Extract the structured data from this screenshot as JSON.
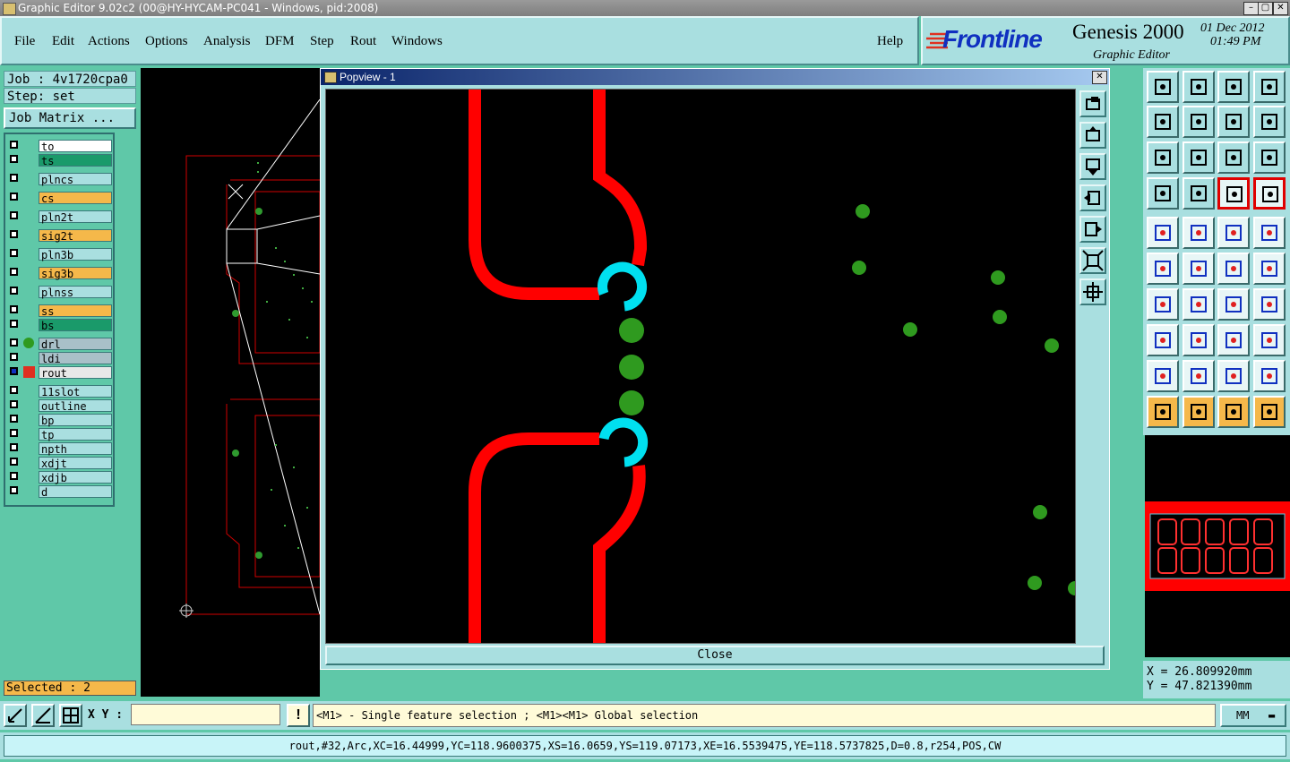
{
  "window": {
    "title": "Graphic Editor 9.02c2 (00@HY-HYCAM-PC041 - Windows, pid:2008)"
  },
  "menu": [
    "File",
    "Edit",
    "Actions",
    "Options",
    "Analysis",
    "DFM",
    "Step",
    "Rout",
    "Windows"
  ],
  "help": "Help",
  "logo": {
    "brand": "Frontline",
    "product": "Genesis 2000",
    "date": "01 Dec 2012",
    "time": "01:49 PM",
    "subtitle": "Graphic Editor"
  },
  "job": {
    "job_label": "Job : 4v1720cpa0",
    "step_label": "Step: set",
    "matrix_button": "Job Matrix ..."
  },
  "layers": [
    {
      "name": "to",
      "color": "#ffffff"
    },
    {
      "name": "ts",
      "color": "#1a9a6a"
    },
    {
      "name": "plncs",
      "color": "#a9dfe0"
    },
    {
      "name": "cs",
      "color": "#f5b84a"
    },
    {
      "name": "pln2t",
      "color": "#a9dfe0"
    },
    {
      "name": "sig2t",
      "color": "#f5b84a"
    },
    {
      "name": "pln3b",
      "color": "#a9dfe0"
    },
    {
      "name": "sig3b",
      "color": "#f5b84a"
    },
    {
      "name": "plnss",
      "color": "#a9dfe0"
    },
    {
      "name": "ss",
      "color": "#f5b84a"
    },
    {
      "name": "bs",
      "color": "#1a9a6a"
    },
    {
      "name": "drl",
      "color": "#a9c0c8"
    },
    {
      "name": "ldi",
      "color": "#a9c0c8"
    },
    {
      "name": "rout",
      "color": "#e8e8e8"
    },
    {
      "name": "11slot",
      "color": "#a9dfe0"
    },
    {
      "name": "outline",
      "color": "#a9dfe0"
    },
    {
      "name": "bp",
      "color": "#a9dfe0"
    },
    {
      "name": "tp",
      "color": "#a9dfe0"
    },
    {
      "name": "npth",
      "color": "#a9dfe0"
    },
    {
      "name": "xdjt",
      "color": "#a9dfe0"
    },
    {
      "name": "xdjb",
      "color": "#a9dfe0"
    },
    {
      "name": "d",
      "color": "#a9dfe0"
    }
  ],
  "selected": "Selected : 2",
  "popup": {
    "title": "Popview - 1",
    "close": "Close"
  },
  "coords": {
    "x": "X  =  26.809920mm",
    "y": "Y  =  47.821390mm"
  },
  "status": {
    "xy_label": "X Y :",
    "hint": "<M1> - Single feature selection ; <M1><M1> Global selection",
    "units": "MM"
  },
  "info": "rout,#32,Arc,XC=16.44999,YC=118.9600375,XS=16.0659,YS=119.07173,XE=16.5539475,YE=118.5737825,D=0.8,r254,POS,CW"
}
